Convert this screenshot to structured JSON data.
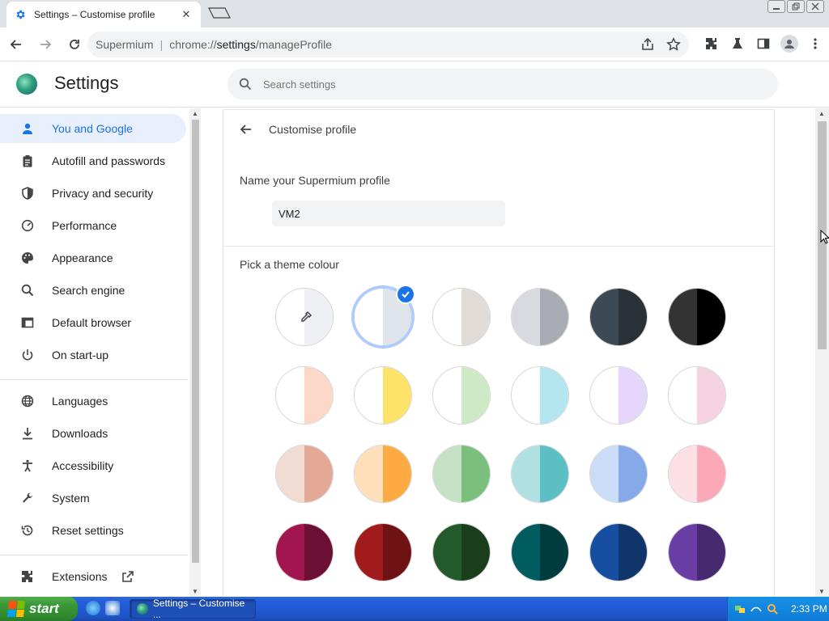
{
  "browser": {
    "tab_title": "Settings – Customise profile",
    "tab_close": "✕",
    "omnibox_site": "Supermium",
    "omnibox_separator": "|",
    "omnibox_path_prefix": "chrome://",
    "omnibox_path_host": "settings",
    "omnibox_path_rest": "/manageProfile"
  },
  "header": {
    "title": "Settings",
    "search_placeholder": "Search settings"
  },
  "sidebar": {
    "items": [
      {
        "label": "You and Google",
        "icon": "person-icon",
        "active": true
      },
      {
        "label": "Autofill and passwords",
        "icon": "clipboard-icon"
      },
      {
        "label": "Privacy and security",
        "icon": "shield-icon"
      },
      {
        "label": "Performance",
        "icon": "speedometer-icon"
      },
      {
        "label": "Appearance",
        "icon": "palette-icon"
      },
      {
        "label": "Search engine",
        "icon": "search-icon"
      },
      {
        "label": "Default browser",
        "icon": "browser-window-icon"
      },
      {
        "label": "On start-up",
        "icon": "power-icon"
      },
      {
        "label": "Languages",
        "icon": "globe-icon"
      },
      {
        "label": "Downloads",
        "icon": "download-icon"
      },
      {
        "label": "Accessibility",
        "icon": "accessibility-icon"
      },
      {
        "label": "System",
        "icon": "wrench-icon"
      },
      {
        "label": "Reset settings",
        "icon": "history-icon"
      },
      {
        "label": "Extensions",
        "icon": "puzzle-icon"
      }
    ]
  },
  "main": {
    "page_title": "Customise profile",
    "name_label": "Name your Supermium profile",
    "name_value": "VM2",
    "theme_label": "Pick a theme colour",
    "swatches": [
      {
        "left": "#ffffff",
        "right": "#eef0f3",
        "type": "picker"
      },
      {
        "left": "#ffffff",
        "right": "#dfe3ea",
        "selected": true
      },
      {
        "left": "#ffffff",
        "right": "#e1dcd8"
      },
      {
        "left": "#d9dadf",
        "right": "#a8aab4"
      },
      {
        "left": "#3c4a54",
        "right": "#293237"
      },
      {
        "left": "#333333",
        "right": "#000000"
      },
      {
        "left": "#ffffff",
        "right": "#fcd8c8"
      },
      {
        "left": "#ffffff",
        "right": "#fde26a"
      },
      {
        "left": "#ffffff",
        "right": "#cde9c5"
      },
      {
        "left": "#ffffff",
        "right": "#b4e6ef"
      },
      {
        "left": "#ffffff",
        "right": "#e6d6fb"
      },
      {
        "left": "#ffffff",
        "right": "#f6d3e0"
      },
      {
        "left": "#f2dbd3",
        "right": "#e3a896"
      },
      {
        "left": "#fde0b9",
        "right": "#fbaa44"
      },
      {
        "left": "#c4e1c4",
        "right": "#7bbf7d"
      },
      {
        "left": "#b0e0e2",
        "right": "#5bbfc4"
      },
      {
        "left": "#cadcf7",
        "right": "#86a9e8"
      },
      {
        "left": "#fde0e5",
        "right": "#fba9b7"
      },
      {
        "left": "#a2164f",
        "right": "#6b0f35"
      },
      {
        "left": "#a11a1c",
        "right": "#6e1214"
      },
      {
        "left": "#235a2b",
        "right": "#1a3d1c"
      },
      {
        "left": "#005c5e",
        "right": "#003c3f"
      },
      {
        "left": "#164fa0",
        "right": "#0f356a"
      },
      {
        "left": "#6a3da4",
        "right": "#46296e"
      }
    ]
  },
  "taskbar": {
    "start_label": "start",
    "task_label": "Settings – Customise ...",
    "clock": "2:33 PM"
  },
  "colors": {
    "accent": "#1a73e8",
    "active_nav_bg": "#e8f0fe"
  }
}
